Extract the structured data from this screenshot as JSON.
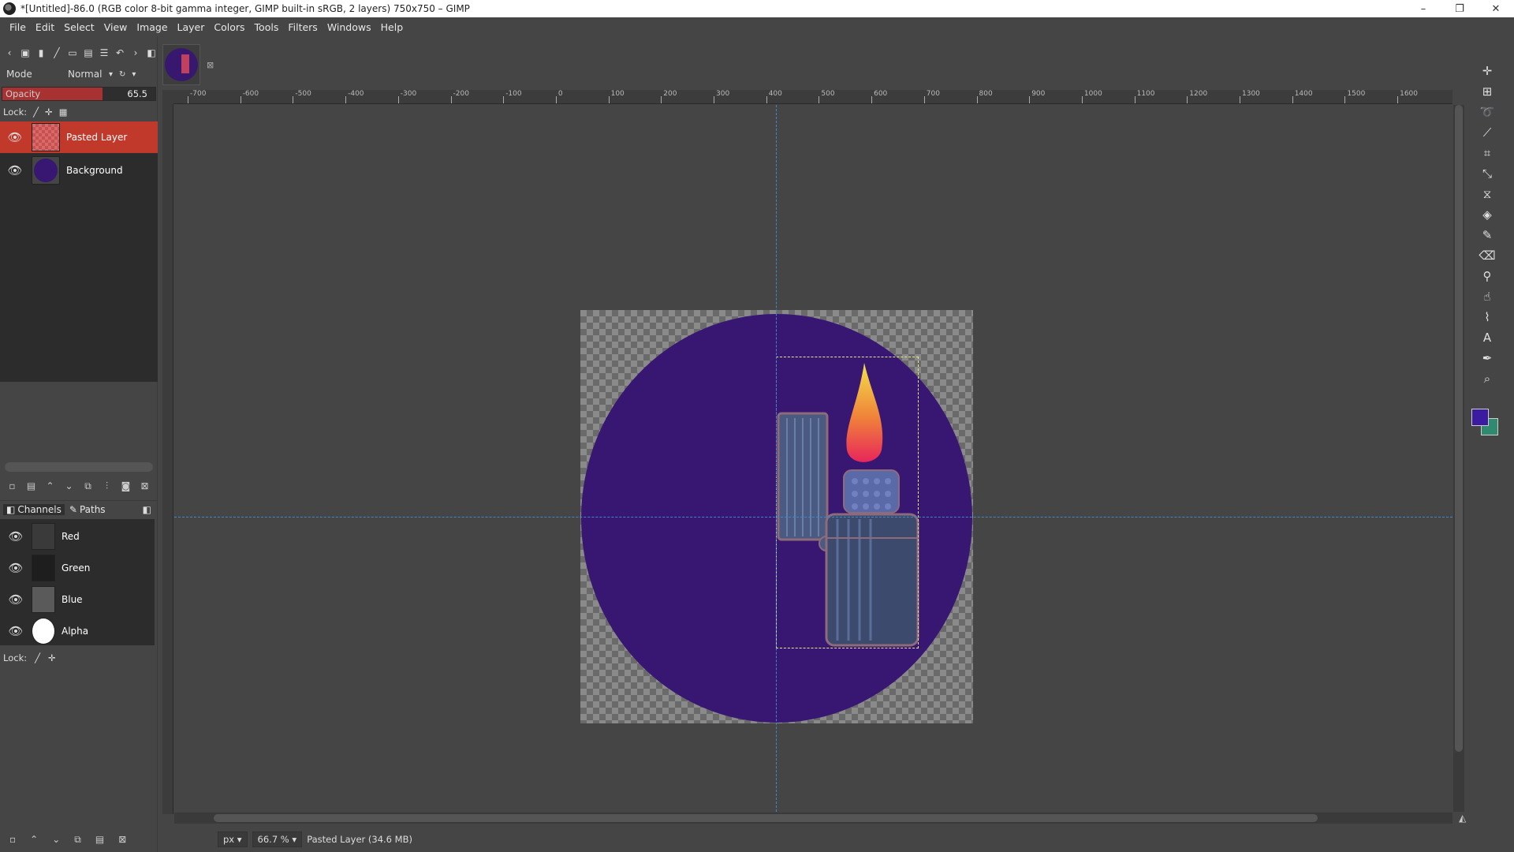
{
  "window": {
    "title": "*[Untitled]-86.0 (RGB color 8-bit gamma integer, GIMP built-in sRGB, 2 layers) 750x750 – GIMP",
    "controls": [
      "–",
      "❐",
      "✕"
    ]
  },
  "menu": [
    "File",
    "Edit",
    "Select",
    "View",
    "Image",
    "Layer",
    "Colors",
    "Tools",
    "Filters",
    "Windows",
    "Help"
  ],
  "layers_panel": {
    "mode_label": "Mode",
    "mode_value": "Normal",
    "opacity_label": "Opacity",
    "opacity_value": "65.5",
    "opacity_fraction": 0.655,
    "lock_label": "Lock:",
    "layers": [
      {
        "name": "Pasted Layer",
        "active": true
      },
      {
        "name": "Background",
        "active": false
      }
    ]
  },
  "channels_panel": {
    "tabs": [
      "Channels",
      "Paths"
    ],
    "channels": [
      "Red",
      "Green",
      "Blue",
      "Alpha"
    ],
    "lock_label": "Lock:"
  },
  "ruler": {
    "labels": [
      "-700",
      "-600",
      "-500",
      "-400",
      "-300",
      "-200",
      "-100",
      "0",
      "100",
      "200",
      "300",
      "400",
      "500",
      "600",
      "700",
      "800",
      "900",
      "1000",
      "1100",
      "1200",
      "1300",
      "1400",
      "1500",
      "1600"
    ]
  },
  "status": {
    "unit": "px",
    "zoom": "66.7 %",
    "info": "Pasted Layer (34.6 MB)"
  },
  "colors": {
    "foreground": "#3b1ca0",
    "background": "#2f8a6f",
    "active_layer_highlight": "#c0392b",
    "circle_fill": "#381773"
  },
  "icons": {
    "toolbox": [
      "move-icon",
      "align-icon",
      "lasso-icon",
      "fuzzy-select-icon",
      "crop-icon",
      "unified-transform-icon",
      "warp-icon",
      "bucket-fill-icon",
      "paintbrush-icon",
      "eraser-icon",
      "clone-icon",
      "smudge-icon",
      "paths-icon",
      "text-icon",
      "color-picker-icon",
      "zoom-icon"
    ]
  }
}
